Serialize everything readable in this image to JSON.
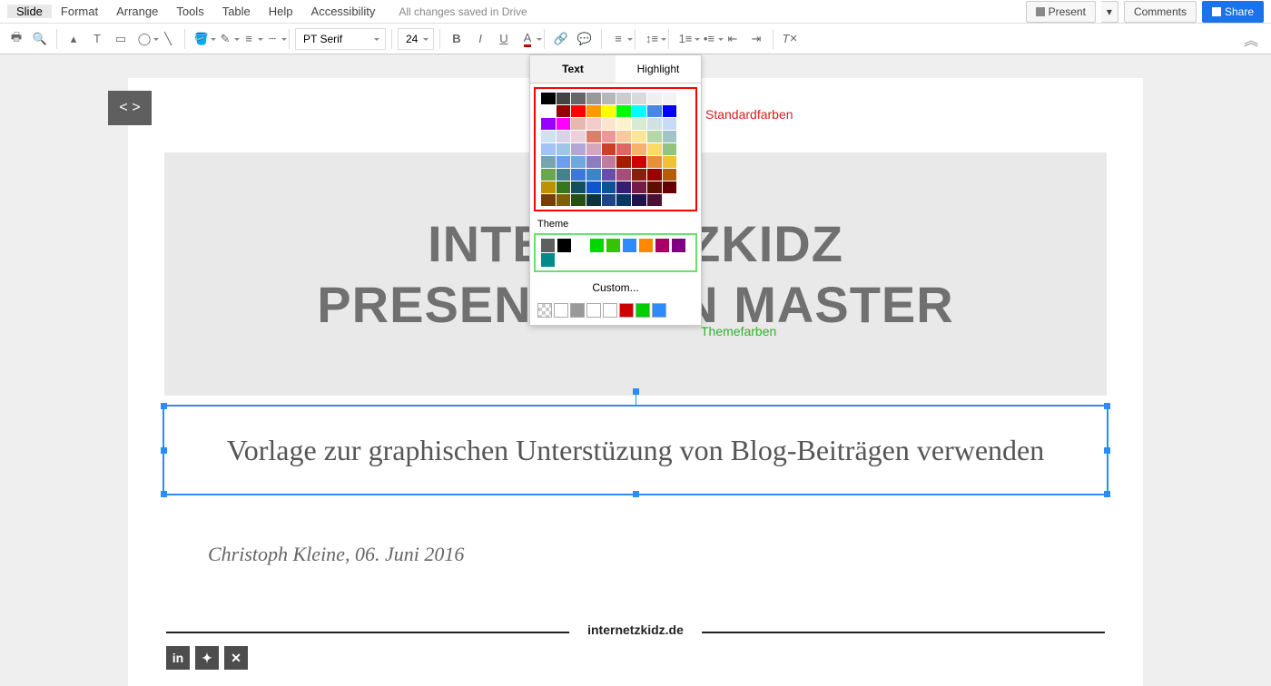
{
  "menus": {
    "slide": "Slide",
    "format": "Format",
    "arrange": "Arrange",
    "tools": "Tools",
    "table": "Table",
    "help": "Help",
    "accessibility": "Accessibility"
  },
  "status": "All changes saved in Drive",
  "buttons": {
    "present": "Present",
    "comments": "Comments",
    "share": "Share"
  },
  "toolbar": {
    "font": "PT Serif",
    "size": "24",
    "bold": "B",
    "italic": "I",
    "underline": "U",
    "textcolor": "A"
  },
  "colorpopup": {
    "tab_text": "Text",
    "tab_highlight": "Highlight",
    "theme_label": "Theme",
    "custom_label": "Custom...",
    "standard_colors": [
      [
        "#000000",
        "#434343",
        "#666666",
        "#999999",
        "#b7b7b7",
        "#cccccc",
        "#d9d9d9",
        "#efefef",
        "#f3f3f3",
        "#ffffff"
      ],
      [
        "#980000",
        "#ff0000",
        "#ff9900",
        "#ffff00",
        "#00ff00",
        "#00ffff",
        "#4a86e8",
        "#0000ff",
        "#9900ff",
        "#ff00ff"
      ],
      [
        "#e6b8af",
        "#f4cccc",
        "#fce5cd",
        "#fff2cc",
        "#d9ead3",
        "#d0e0e3",
        "#c9daf8",
        "#cfe2f3",
        "#d9d2e9",
        "#ead1dc"
      ],
      [
        "#dd7e6b",
        "#ea9999",
        "#f9cb9c",
        "#ffe599",
        "#b6d7a8",
        "#a2c4c9",
        "#a4c2f4",
        "#9fc5e8",
        "#b4a7d6",
        "#d5a6bd"
      ],
      [
        "#cc4125",
        "#e06666",
        "#f6b26b",
        "#ffd966",
        "#93c47d",
        "#76a5af",
        "#6d9eeb",
        "#6fa8dc",
        "#8e7cc3",
        "#c27ba0"
      ],
      [
        "#a61c00",
        "#cc0000",
        "#e69138",
        "#f1c232",
        "#6aa84f",
        "#45818e",
        "#3c78d8",
        "#3d85c6",
        "#674ea7",
        "#a64d79"
      ],
      [
        "#85200c",
        "#990000",
        "#b45f06",
        "#bf9000",
        "#38761d",
        "#134f5c",
        "#1155cc",
        "#0b5394",
        "#351c75",
        "#741b47"
      ],
      [
        "#5b0f00",
        "#660000",
        "#783f04",
        "#7f6000",
        "#274e13",
        "#0c343d",
        "#1c4587",
        "#073763",
        "#20124d",
        "#4c1130"
      ]
    ],
    "theme_colors": [
      "#5f5f5f",
      "#000000",
      "#ffffff",
      "#00d800",
      "#33c600",
      "#2a8cff",
      "#ff8800",
      "#aa0066",
      "#800080",
      "#008b8b"
    ],
    "custom_colors": [
      "#ffffff",
      "#999999",
      "#ffffff",
      "#ffffff",
      "#cc0000",
      "#00cc00",
      "#2a8cff"
    ]
  },
  "annotations": {
    "standard": "Standardfarben",
    "theme": "Themefarben"
  },
  "slide": {
    "title_line1": "INTERNETZKIDZ",
    "title_line2": "PRESENTATION MASTER",
    "subtitle": "Vorlage zur graphischen Unterstüzung von Blog-Beiträgen verwenden",
    "author": "Christoph Kleine, 06. Juni 2016",
    "footer": "internetzkidz.de",
    "code_badge": "< >"
  },
  "social": [
    "in",
    "𝕏",
    "X"
  ]
}
